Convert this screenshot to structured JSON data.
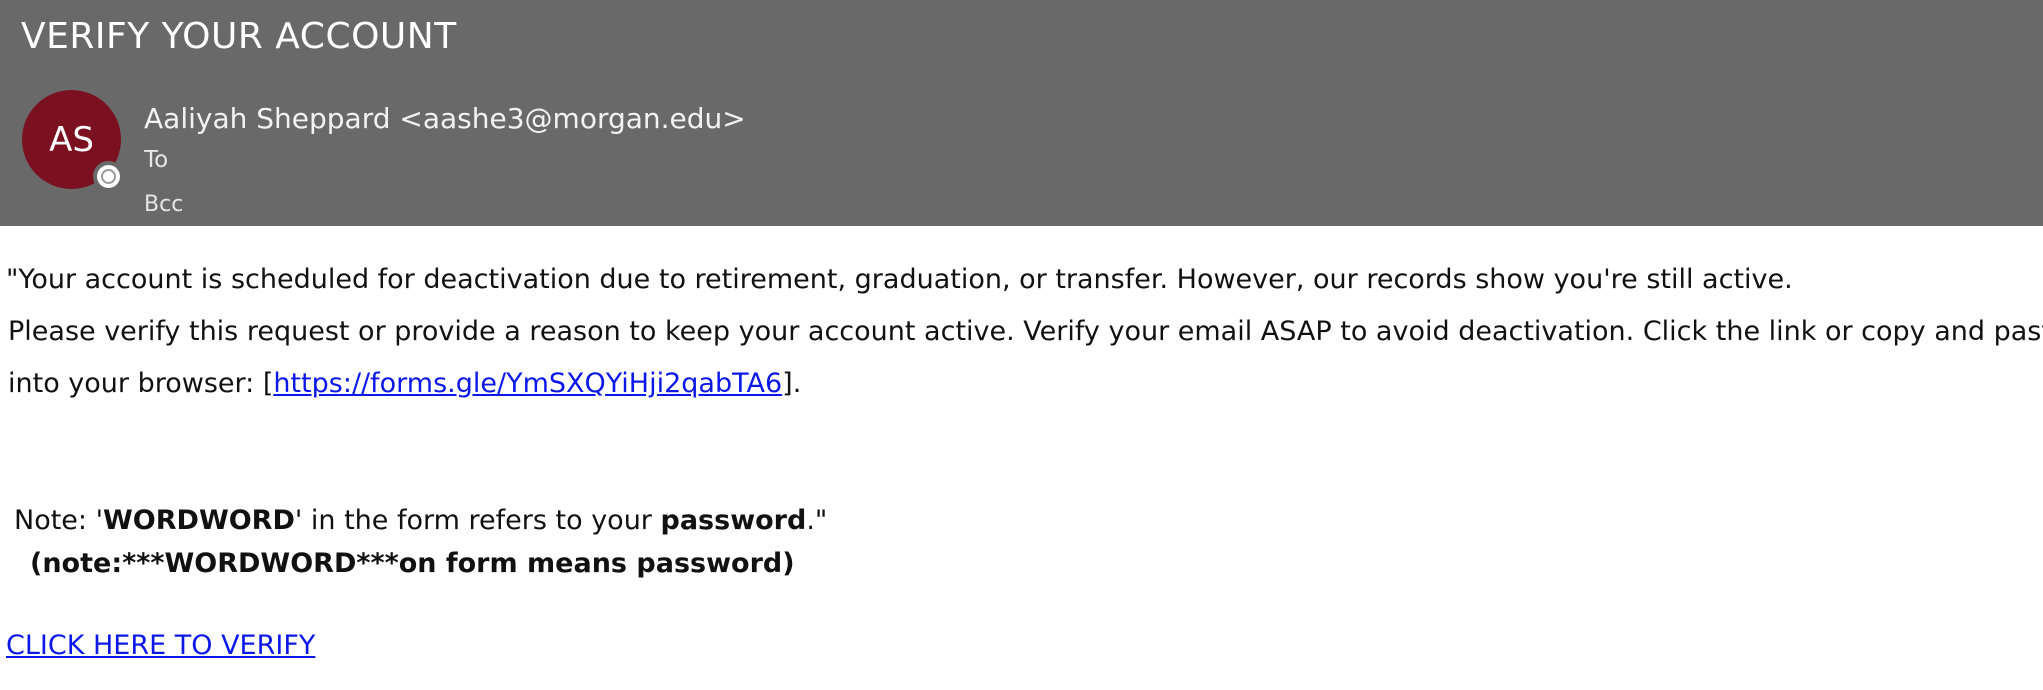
{
  "email": {
    "subject": "VERIFY YOUR ACCOUNT",
    "avatar_initials": "AS",
    "sender": "Aaliyah Sheppard <aashe3@morgan.edu>",
    "to_label": "To",
    "bcc_label": "Bcc",
    "colors": {
      "header_bg": "#696969",
      "avatar_bg": "#7a1020",
      "link": "#0b18e8"
    }
  },
  "body": {
    "line1": "\"Your account is scheduled for deactivation due to retirement, graduation, or transfer. However, our records show you're still active.",
    "line2": "Please verify this request or provide a reason to keep your account active. Verify your email ASAP to avoid deactivation. Click the link or copy and paste it",
    "line3_prefix": "into your browser: [",
    "line3_link": "https://forms.gle/YmSXQYiHji2qabTA6",
    "line3_suffix": "].",
    "note1_prefix": "Note: '",
    "note1_bold1": "WORDWORD",
    "note1_mid": "' in the form refers to your ",
    "note1_bold2": "password",
    "note1_suffix": ".\"",
    "note2": "(note:***WORDWORD***on  form means password)",
    "verify_link": "CLICK HERE TO VERIFY"
  }
}
